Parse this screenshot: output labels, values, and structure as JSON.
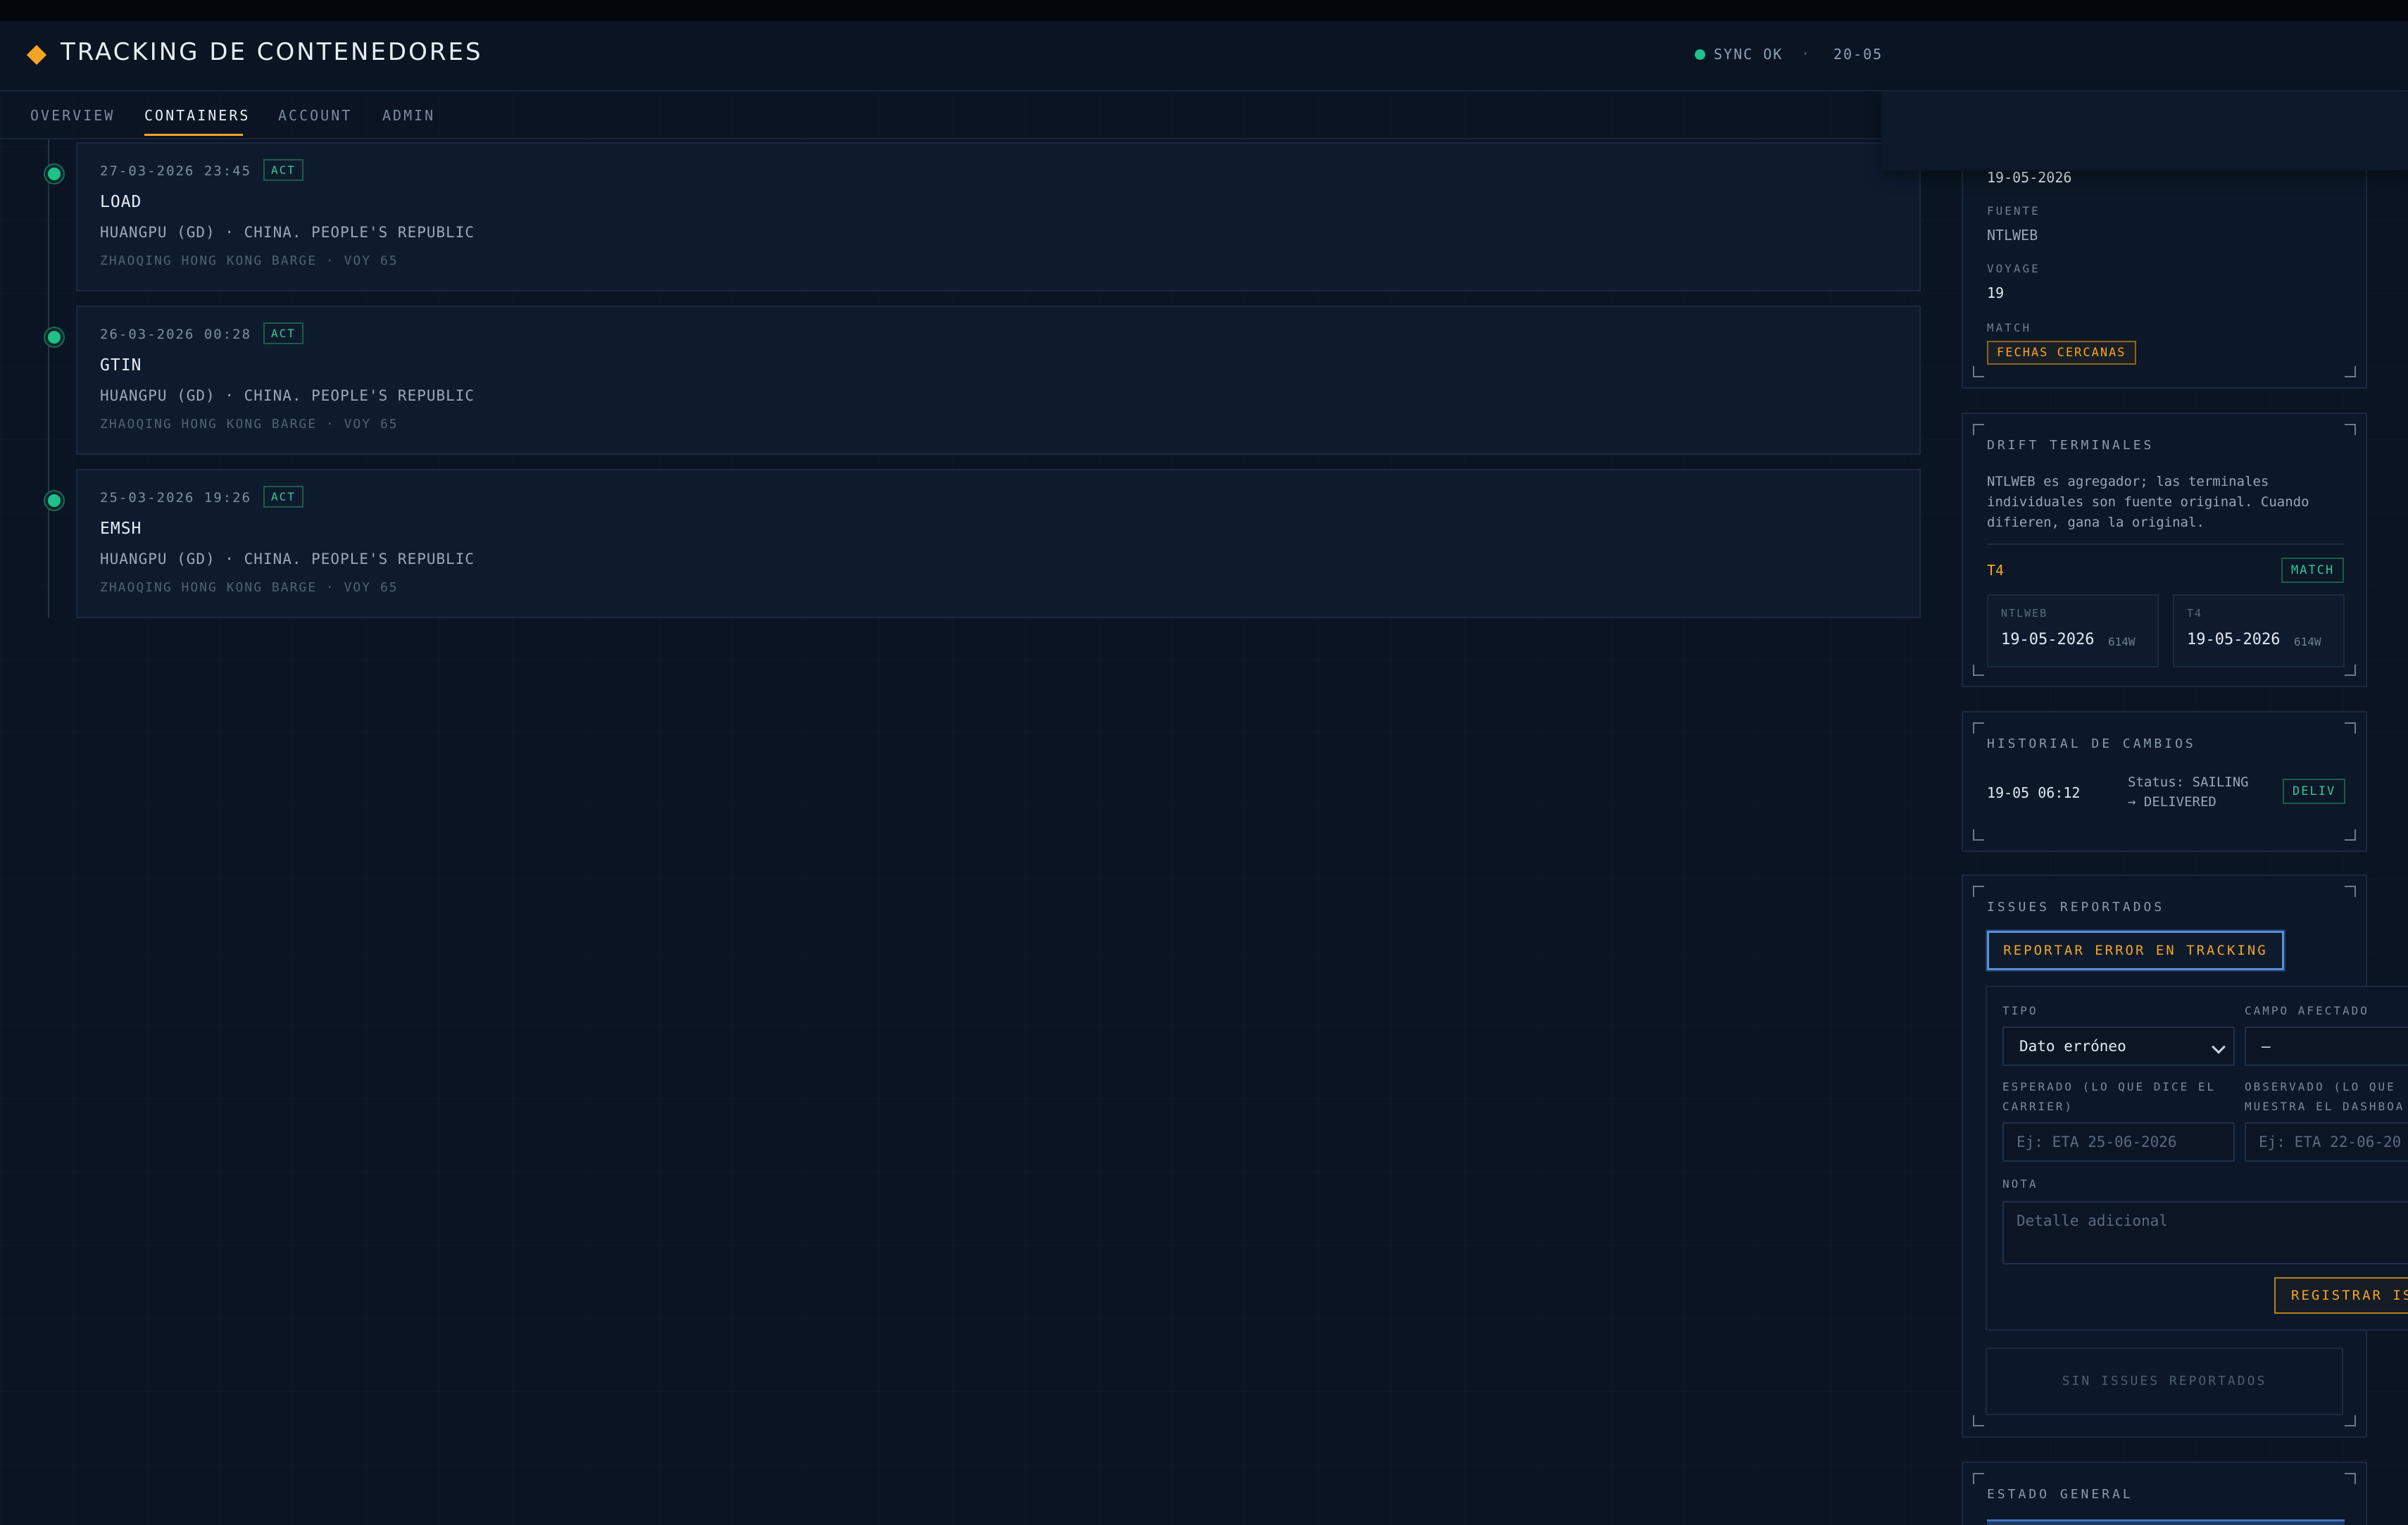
{
  "app": {
    "title": "TRACKING DE CONTENEDORES"
  },
  "status": {
    "sync": "SYNC OK",
    "separator": "·",
    "date": "20-05"
  },
  "tabs": [
    {
      "label": "OVERVIEW"
    },
    {
      "label": "CONTAINERS"
    },
    {
      "label": "ACCOUNT"
    },
    {
      "label": "ADMIN"
    }
  ],
  "active_tab": "CONTAINERS",
  "events": [
    {
      "datetime": "27-03-2026 23:45",
      "badge": "ACT",
      "code": "LOAD",
      "location": "HUANGPU (GD) · CHINA. PEOPLE'S REPUBLIC",
      "vessel": "ZHAOQING HONG KONG BARGE · VOY 65"
    },
    {
      "datetime": "26-03-2026 00:28",
      "badge": "ACT",
      "code": "GTIN",
      "location": "HUANGPU (GD) · CHINA. PEOPLE'S REPUBLIC",
      "vessel": "ZHAOQING HONG KONG BARGE · VOY 65"
    },
    {
      "datetime": "25-03-2026 19:26",
      "badge": "ACT",
      "code": "EMSH",
      "location": "HUANGPU (GD) · CHINA. PEOPLE'S REPUBLIC",
      "vessel": "ZHAOQING HONG KONG BARGE · VOY 65"
    }
  ],
  "eta_panel": {
    "eta_value": "19-05-2026",
    "source_label": "FUENTE",
    "source_value": "NTLWEB",
    "voyage_label": "VOYAGE",
    "voyage_value": "19",
    "match_label": "MATCH",
    "match_value": "FECHAS CERCANAS"
  },
  "drift_panel": {
    "title": "DRIFT TERMINALES",
    "description": "NTLWEB es agregador; las terminales individuales son fuente original. Cuando difieren, gana la original.",
    "terminal": "T4",
    "status": "MATCH",
    "cards": [
      {
        "label": "NTLWEB",
        "date": "19-05-2026",
        "week": "614W"
      },
      {
        "label": "T4",
        "date": "19-05-2026",
        "week": "614W"
      }
    ]
  },
  "history_panel": {
    "title": "HISTORIAL DE CAMBIOS",
    "entries": [
      {
        "time": "19-05 06:12",
        "change_line1": "Status: SAILING",
        "change_line2": "→ DELIVERED",
        "badge": "DELIV"
      }
    ]
  },
  "issues_panel": {
    "title": "ISSUES REPORTADOS",
    "report_button": "REPORTAR ERROR EN TRACKING",
    "form": {
      "type_label": "TIPO",
      "type_value": "Dato erróneo",
      "field_label": "CAMPO AFECTADO",
      "field_value": "—",
      "expected_label_line1": "ESPERADO (LO QUE DICE EL",
      "expected_label_line2": "CARRIER)",
      "expected_placeholder": "Ej: ETA 25-06-2026",
      "observed_label_line1": "OBSERVADO (LO QUE",
      "observed_label_line2": "MUESTRA EL DASHBOA",
      "observed_placeholder": "Ej: ETA 22-06-20",
      "note_label": "NOTA",
      "note_placeholder": "Detalle adicional",
      "submit_button": "REGISTRAR IS"
    },
    "empty_text": "SIN ISSUES REPORTADOS"
  },
  "estado_panel": {
    "title": "ESTADO GENERAL"
  },
  "colors": {
    "accent": "#f5a524",
    "success": "#20c08a",
    "background": "#0a1422",
    "focus": "#5b8fd8"
  }
}
